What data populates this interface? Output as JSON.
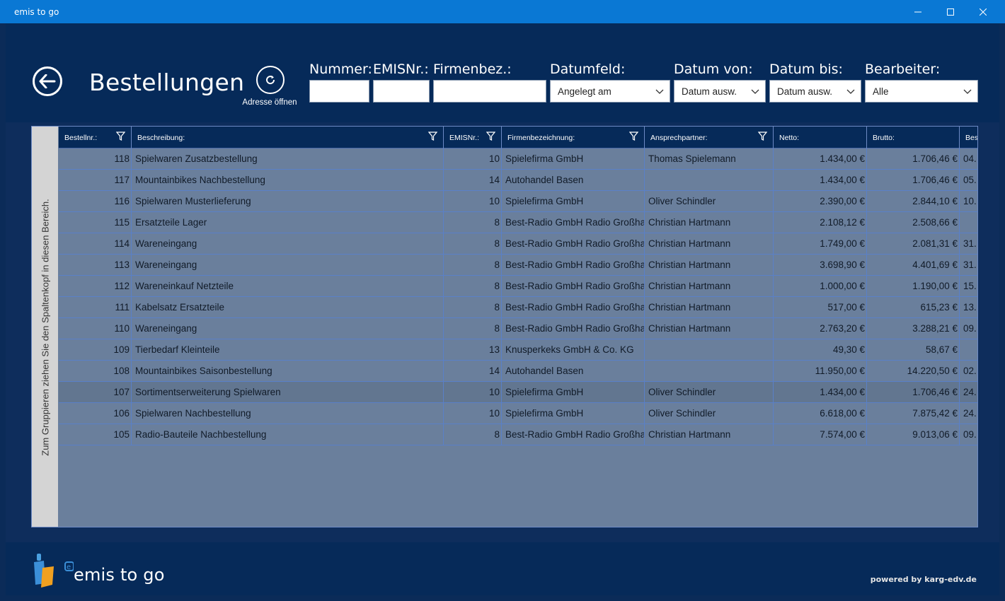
{
  "window": {
    "title": "emis to go"
  },
  "header": {
    "title": "Bestellungen",
    "address_label": "Adresse öffnen"
  },
  "filters": {
    "nummer_label": "Nummer:",
    "emisnr_label": "EMISNr.:",
    "firmenbez_label": "Firmenbez.:",
    "datumfeld_label": "Datumfeld:",
    "datumfeld_value": "Angelegt am",
    "datum_von_label": "Datum von:",
    "datum_von_value": "Datum ausw.",
    "datum_bis_label": "Datum bis:",
    "datum_bis_value": "Datum ausw.",
    "bearbeiter_label": "Bearbeiter:",
    "bearbeiter_value": "Alle"
  },
  "grid": {
    "group_hint": "Zum Gruppieren ziehen Sie den Spaltenkopf in diesen Bereich.",
    "columns": [
      "Bestellnr.:",
      "Beschreibung:",
      "EMISNr.:",
      "Firmenbezeichnung:",
      "Ansprechpartner:",
      "Netto:",
      "Brutto:",
      "Bes"
    ],
    "rows": [
      [
        "118",
        "Spielwaren Zusatzbestellung",
        "10",
        "Spielefirma GmbH",
        "Thomas Spielemann",
        "1.434,00 €",
        "1.706,46 €",
        "04."
      ],
      [
        "117",
        "Mountainbikes Nachbestellung",
        "14",
        "Autohandel Basen",
        "",
        "1.434,00 €",
        "1.706,46 €",
        "05."
      ],
      [
        "116",
        "Spielwaren Musterlieferung",
        "10",
        "Spielefirma GmbH",
        "Oliver Schindler",
        "2.390,00 €",
        "2.844,10 €",
        "10."
      ],
      [
        "115",
        "Ersatzteile Lager",
        "8",
        "Best-Radio GmbH Radio Großhandel",
        "Christian Hartmann",
        "2.108,12 €",
        "2.508,66 €",
        ""
      ],
      [
        "114",
        "Wareneingang",
        "8",
        "Best-Radio GmbH Radio Großhandel",
        "Christian Hartmann",
        "1.749,00 €",
        "2.081,31 €",
        "31."
      ],
      [
        "113",
        "Wareneingang",
        "8",
        "Best-Radio GmbH Radio Großhandel",
        "Christian Hartmann",
        "3.698,90 €",
        "4.401,69 €",
        "31."
      ],
      [
        "112",
        "Wareneinkauf Netzteile",
        "8",
        "Best-Radio GmbH Radio Großhandel",
        "Christian Hartmann",
        "1.000,00 €",
        "1.190,00 €",
        "15."
      ],
      [
        "111",
        "Kabelsatz Ersatzteile",
        "8",
        "Best-Radio GmbH Radio Großhandel",
        "Christian Hartmann",
        "517,00 €",
        "615,23 €",
        "13."
      ],
      [
        "110",
        "Wareneingang",
        "8",
        "Best-Radio GmbH Radio Großhandel",
        "Christian Hartmann",
        "2.763,20 €",
        "3.288,21 €",
        "09."
      ],
      [
        "109",
        "Tierbedarf Kleinteile",
        "13",
        "Knusperkeks GmbH & Co. KG",
        "",
        "49,30 €",
        "58,67 €",
        ""
      ],
      [
        "108",
        "Mountainbikes Saisonbestellung",
        "14",
        "Autohandel Basen",
        "",
        "11.950,00 €",
        "14.220,50 €",
        "02."
      ],
      [
        "107",
        "Sortimentserweiterung Spielwaren",
        "10",
        "Spielefirma GmbH",
        "Oliver Schindler",
        "1.434,00 €",
        "1.706,46 €",
        "24."
      ],
      [
        "106",
        "Spielwaren Nachbestellung",
        "10",
        "Spielefirma GmbH",
        "Oliver Schindler",
        "6.618,00 €",
        "7.875,42 €",
        "24."
      ],
      [
        "105",
        "Radio-Bauteile Nachbestellung",
        "8",
        "Best-Radio GmbH Radio Großhandel",
        "Christian Hartmann",
        "7.574,00 €",
        "9.013,06 €",
        "09."
      ]
    ],
    "selected_row": 11
  },
  "footer": {
    "logo_text": "emis to go",
    "powered_by": "powered by karg-edv.de"
  },
  "colors": {
    "titlebar": "#0a78d4",
    "header": "#062a59",
    "grid_bg": "#6a7f9c"
  }
}
